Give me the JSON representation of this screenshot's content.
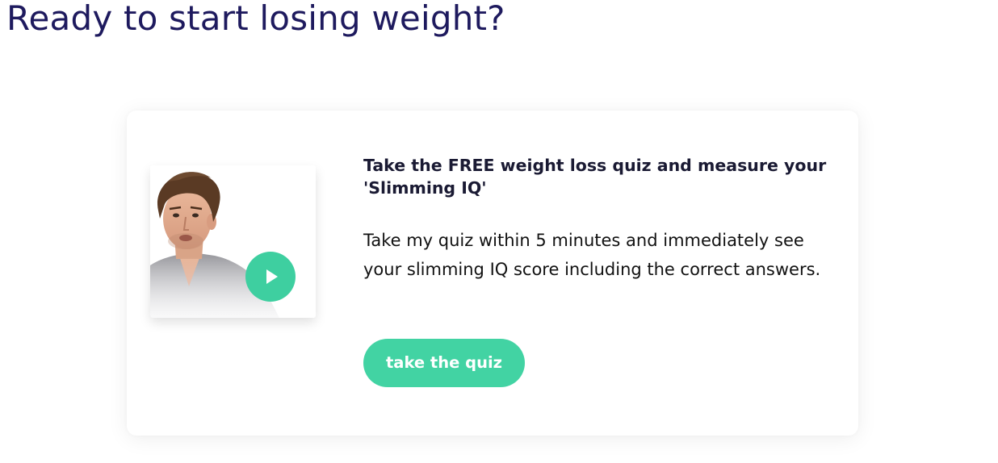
{
  "page": {
    "title": "Ready to start losing weight?"
  },
  "quiz_card": {
    "video": {
      "image": "presenter-thumbnail",
      "play_icon": "play-icon"
    },
    "heading": "Take the FREE weight loss quiz and measure your 'Slimming IQ'",
    "description": "Take my quiz within 5 minutes and immediately see your slimming IQ score including the correct answers.",
    "button_label": "take the quiz"
  },
  "colors": {
    "title": "#1e1a5e",
    "accent": "#42d3a3",
    "card_background": "#ffffff",
    "text": "#111111"
  }
}
